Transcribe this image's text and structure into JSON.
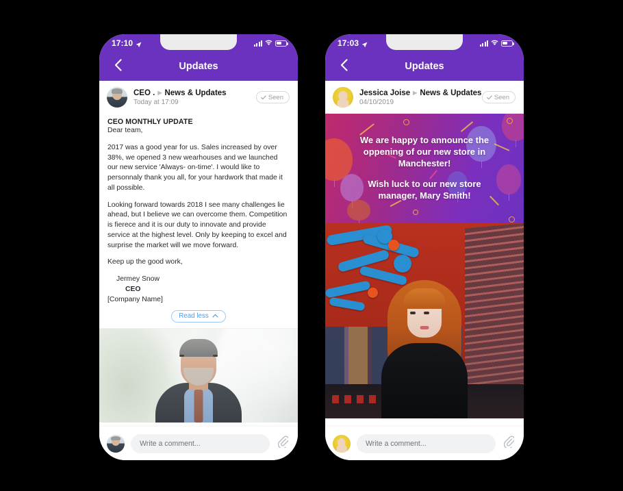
{
  "phones": [
    {
      "id": "left",
      "status": {
        "time": "17:10",
        "location_icon": "location-arrow-icon",
        "signal_icon": "cellular-signal-icon",
        "wifi_icon": "wifi-icon",
        "battery_icon": "battery-icon"
      },
      "nav": {
        "back_icon": "chevron-left-icon",
        "title": "Updates"
      },
      "post_header": {
        "avatar": "author-avatar-ceo",
        "author": "CEO .",
        "separator_icon": "play-triangle-icon",
        "channel": "News & Updates",
        "timestamp": "Today at 17:09",
        "seen_label": "Seen",
        "seen_icon": "check-icon"
      },
      "post": {
        "title": "CEO MONTHLY UPDATE",
        "greeting": "Dear team,",
        "paragraph1": "2017 was a good year for us. Sales increased by over 38%, we opened 3 new wearhouses and we launched our new service 'Always- on-time'. I would like to personnaly thank you all, for your hardwork that made it all possible.",
        "paragraph2": "Looking forward towards 2018 I see many challenges lie ahead, but I believe we can overcome them. Competition is fierece and it is our duty to innovate and provide service at the highest level. Only by keeping to excel and surprise the market will we move forward.",
        "closing": "Keep up the good work,",
        "signature_name": "Jermey Snow",
        "signature_role": "CEO",
        "signature_company": "[Company Name]",
        "read_less_label": "Read less",
        "read_less_icon": "chevron-up-icon",
        "photo_alt": "businessman-in-grey-suit-photo"
      },
      "comment": {
        "avatar": "commenter-avatar-ceo",
        "placeholder": "Write a comment...",
        "value": "",
        "attach_icon": "paperclip-icon"
      }
    },
    {
      "id": "right",
      "status": {
        "time": "17:03",
        "location_icon": "location-arrow-icon",
        "signal_icon": "cellular-signal-icon",
        "wifi_icon": "wifi-icon",
        "battery_icon": "battery-icon"
      },
      "nav": {
        "back_icon": "chevron-left-icon",
        "title": "Updates"
      },
      "post_header": {
        "avatar": "author-avatar-jessica",
        "author": "Jessica Joise",
        "separator_icon": "play-triangle-icon",
        "channel": "News & Updates",
        "timestamp": "04/10/2019",
        "seen_label": "Seen",
        "seen_icon": "check-icon"
      },
      "banner": {
        "line1": "We are happy to announce the",
        "line2": "oppening of our new store in",
        "line3": "Manchester!",
        "line4": "Wish luck to our new store",
        "line5": "manager, Mary Smith!",
        "alt": "celebration-balloons-confetti-banner"
      },
      "photo": {
        "alt": "woman-with-red-hair-in-record-store-photo"
      },
      "comment": {
        "avatar": "commenter-avatar-jessica",
        "placeholder": "Write a comment...",
        "value": "",
        "attach_icon": "paperclip-icon"
      }
    }
  ],
  "theme": {
    "purple": "#6b32bf",
    "background": "#000000",
    "link_blue": "#4a9cf0",
    "muted_grey": "#8d9299",
    "banner_from": "#c02a6b",
    "banner_to": "#6b32bf"
  }
}
